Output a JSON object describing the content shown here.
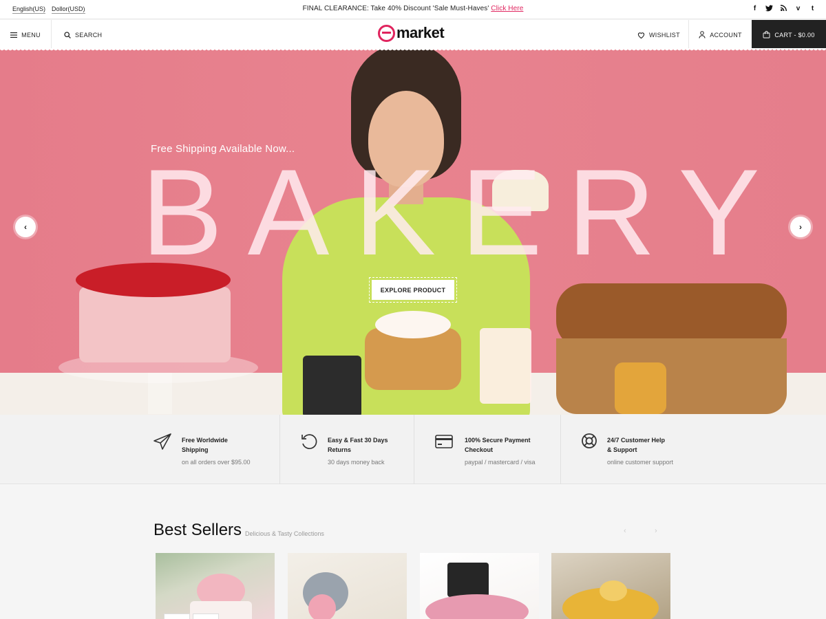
{
  "topbar": {
    "language": "English(US)",
    "currency": "Dollor(USD)",
    "promo_text": "FINAL CLEARANCE: Take 40% Discount 'Sale Must-Haves' ",
    "promo_link": "Click Here",
    "social": [
      {
        "icon": "facebook-icon",
        "glyph": "f"
      },
      {
        "icon": "twitter-icon",
        "glyph": "t"
      },
      {
        "icon": "rss-icon",
        "glyph": "r"
      },
      {
        "icon": "vimeo-icon",
        "glyph": "v"
      },
      {
        "icon": "tumblr-icon",
        "glyph": "t"
      }
    ]
  },
  "header": {
    "menu_label": "MENU",
    "search_label": "SEARCH",
    "logo_text": "market",
    "wishlist_label": "WISHLIST",
    "account_label": "ACCOUNT",
    "cart_label": "CART - $0.00"
  },
  "hero": {
    "subtitle": "Free Shipping Available Now...",
    "title": "BAKERY",
    "cta_label": "EXPLORE PRODUCT",
    "prev_glyph": "‹",
    "next_glyph": "›"
  },
  "features": [
    {
      "icon": "paper-plane-icon",
      "line1": "Free Worldwide",
      "line2": "Shipping",
      "note": "on all orders over $95.00"
    },
    {
      "icon": "return-icon",
      "line1": "Easy & Fast 30 Days",
      "line2": "Returns",
      "note": "30 days money back"
    },
    {
      "icon": "credit-card-icon",
      "line1": "100% Secure Payment",
      "line2": "Checkout",
      "note": "paypal / mastercard / visa"
    },
    {
      "icon": "lifebuoy-icon",
      "line1": "24/7 Customer Help",
      "line2": "& Support",
      "note": "online customer support"
    }
  ],
  "best_sellers": {
    "title": "Best Sellers",
    "subtitle": "Delicious & Tasty Collections",
    "prev_glyph": "‹",
    "next_glyph": "›"
  },
  "colors": {
    "accent": "#e0245e",
    "hero_bg": "#e8838f",
    "cart_bg": "#222222"
  }
}
